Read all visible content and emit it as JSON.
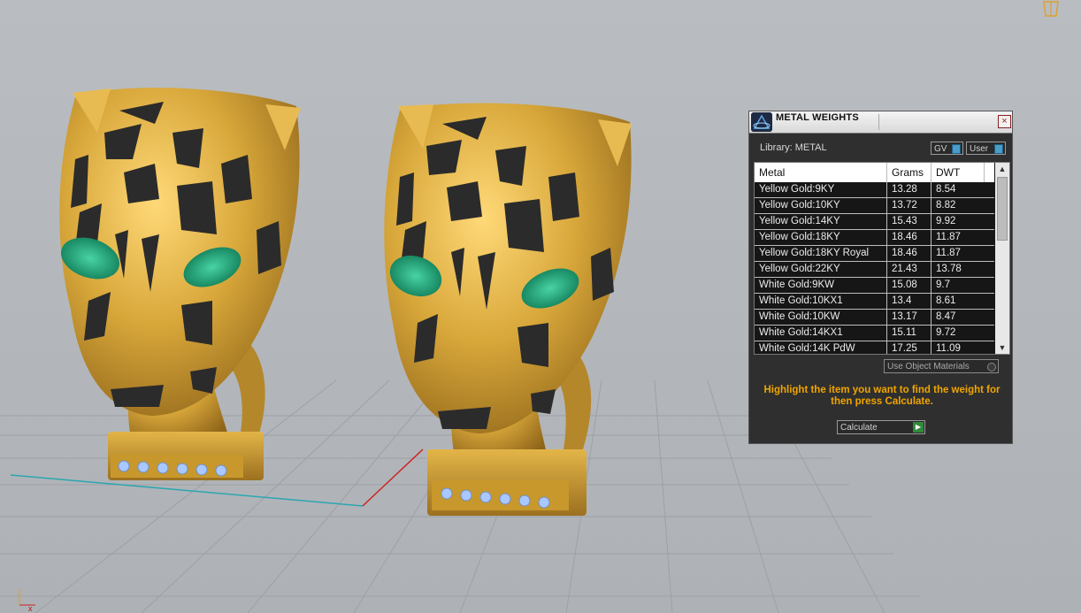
{
  "panel": {
    "title": "METAL WEIGHTS",
    "close_label": "×",
    "library_label": "Library: METAL",
    "gv_label": "GV",
    "user_label": "User",
    "use_object_label": "Use Object Materials",
    "hint_text": "Highlight the item you want to find the weight for then press Calculate.",
    "calculate_label": "Calculate",
    "columns": [
      "Metal",
      "Grams",
      "DWT"
    ],
    "rows": [
      {
        "metal": "Yellow Gold:9KY",
        "grams": "13.28",
        "dwt": "8.54"
      },
      {
        "metal": "Yellow Gold:10KY",
        "grams": "13.72",
        "dwt": "8.82"
      },
      {
        "metal": "Yellow Gold:14KY",
        "grams": "15.43",
        "dwt": "9.92"
      },
      {
        "metal": "Yellow Gold:18KY",
        "grams": "18.46",
        "dwt": "11.87"
      },
      {
        "metal": "Yellow Gold:18KY Royal",
        "grams": "18.46",
        "dwt": "11.87"
      },
      {
        "metal": "Yellow Gold:22KY",
        "grams": "21.43",
        "dwt": "13.78"
      },
      {
        "metal": "White Gold:9KW",
        "grams": "15.08",
        "dwt": "9.7"
      },
      {
        "metal": "White Gold:10KX1",
        "grams": "13.4",
        "dwt": "8.61"
      },
      {
        "metal": "White Gold:10KW",
        "grams": "13.17",
        "dwt": "8.47"
      },
      {
        "metal": "White Gold:14KX1",
        "grams": "15.11",
        "dwt": "9.72"
      },
      {
        "metal": "White Gold:14K PdW",
        "grams": "17.25",
        "dwt": "11.09"
      }
    ]
  },
  "icons": {
    "viewport_axis": "axis-gizmo-icon",
    "camera": "camera-icon",
    "panel_logo": "app-logo-icon"
  },
  "colors": {
    "gold": "#c99a2c",
    "spots": "#2a2a2a",
    "eyes": "#1fa37a",
    "gems": "#8fb4f0",
    "hint": "#f0a500",
    "viewport_bg": "#b8bcc0"
  }
}
